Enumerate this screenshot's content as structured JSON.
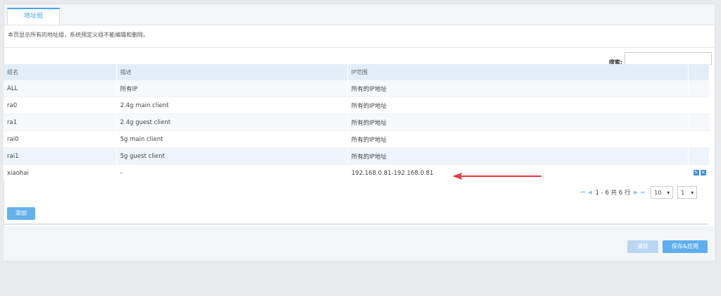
{
  "tabs": [
    {
      "label": "地址组"
    }
  ],
  "description": "本页显示所有的地址组，系统预定义组不能编辑和删除。",
  "search": {
    "label": "搜索:",
    "value": ""
  },
  "table": {
    "headers": [
      "组名",
      "描述",
      "IP范围",
      ""
    ],
    "rows": [
      {
        "name": "ALL",
        "desc": "所有IP",
        "range": "所有的IP地址"
      },
      {
        "name": "ra0",
        "desc": "2.4g main client",
        "range": "所有的IP地址"
      },
      {
        "name": "ra1",
        "desc": "2.4g guest client",
        "range": "所有的IP地址"
      },
      {
        "name": "rai0",
        "desc": "5g main client",
        "range": "所有的IP地址"
      },
      {
        "name": "rai1",
        "desc": "5g guest client",
        "range": "所有的IP地址"
      },
      {
        "name": "xiaohai",
        "desc": "-",
        "range": "192.168.0.81-192.168.0.81"
      }
    ]
  },
  "pagination": {
    "info": "1 - 6 共 6 行",
    "page_size": "10",
    "page": "1"
  },
  "buttons": {
    "add": "添加",
    "clear": "清除",
    "save_apply": "保存&应用"
  },
  "colors": {
    "accent": "#4aa4e8",
    "header_bg": "#e1eef9",
    "arrow": "#e8353a"
  }
}
